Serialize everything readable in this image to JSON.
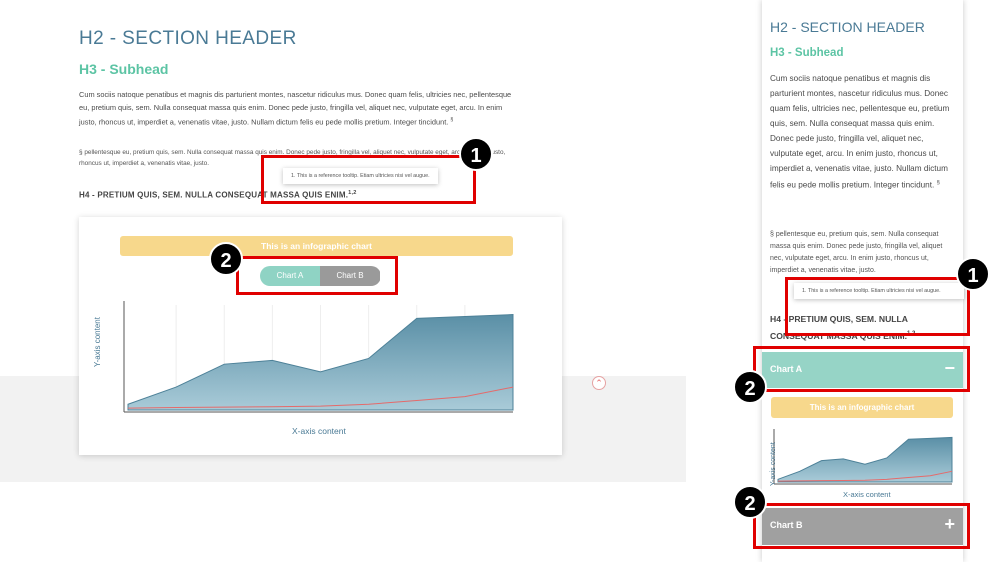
{
  "desktop": {
    "h2": "H2 - SECTION HEADER",
    "h3": "H3 - Subhead",
    "paragraph": "Cum sociis natoque penatibus et magnis dis parturient montes, nascetur ridiculus mus. Donec quam felis, ultricies nec, pellentesque eu, pretium quis, sem. Nulla consequat massa quis enim. Donec pede justo, fringilla vel, aliquet nec, vulputate eget, arcu. In enim justo, rhoncus ut, imperdiet a, venenatis vitae, justo. Nullam dictum felis eu pede mollis pretium. Integer tincidunt.",
    "paragraph_sup": "§",
    "small_text": "§ pellentesque eu, pretium quis, sem. Nulla consequat massa quis enim. Donec pede justo, fringilla vel, aliquet nec, vulputate eget, arcu. In enim justo, rhoncus ut, imperdiet a, venenatis vitae, justo.",
    "tooltip": "1. This is a reference tooltip. Etiam ultricies nisi vel augue.",
    "h4": "H4 - PRETIUM QUIS, SEM. NULLA CONSEQUAT MASSA QUIS ENIM.",
    "h4_sup": "1,2",
    "chart_banner": "This is an infographic chart",
    "toggle_a": "Chart A",
    "toggle_b": "Chart B",
    "ylabel": "Y-axis content",
    "xlabel": "X-axis content",
    "scroll_up_glyph": "⌃"
  },
  "mobile": {
    "h2": "H2 - SECTION HEADER",
    "h3": "H3 - Subhead",
    "paragraph": "Cum sociis natoque penatibus et magnis dis parturient montes, nascetur ridiculus mus. Donec quam felis, ultricies nec, pellentesque eu, pretium quis, sem. Nulla consequat massa quis enim. Donec pede justo, fringilla vel, aliquet nec, vulputate eget, arcu. In enim justo, rhoncus ut, imperdiet a, venenatis vitae, justo. Nullam dictum felis eu pede mollis pretium. Integer tincidunt.",
    "paragraph_sup": "§",
    "small_text": "§ pellentesque eu, pretium quis, sem. Nulla consequat massa quis enim. Donec pede justo, fringilla vel, aliquet nec, vulputate eget, arcu. In enim justo, rhoncus ut, imperdiet a, venenatis vitae, justo.",
    "tooltip": "1. This is a reference tooltip. Etiam ultricies nisi vel augue.",
    "h4": "H4 - PRETIUM QUIS, SEM. NULLA CONSEQUAT MASSA QUIS ENIM.",
    "h4_sup": "1,2",
    "accordion_a": "Chart A",
    "accordion_a_icon": "−",
    "accordion_b": "Chart B",
    "accordion_b_icon": "+",
    "chart_banner": "This is an infographic chart",
    "ylabel": "Y-axis content",
    "xlabel": "X-axis content"
  },
  "callouts": {
    "badge_1": "1",
    "badge_2": "2"
  },
  "colors": {
    "header_blue": "#4a7a95",
    "subhead_green": "#5cc4a4",
    "banner_yellow": "#f7d88c",
    "area_fill": "#5a8fa6",
    "trend_line": "#e56a6a",
    "callout_red": "#e00000"
  },
  "chart_data": {
    "type": "area",
    "title": "This is an infographic chart",
    "xlabel": "X-axis content",
    "ylabel": "Y-axis content",
    "x": [
      0,
      1,
      2,
      3,
      4,
      5,
      6,
      7,
      8
    ],
    "series": [
      {
        "values": [
          3,
          12,
          24,
          26,
          20,
          27,
          48,
          49,
          50
        ]
      },
      {
        "values": [
          1,
          1.3,
          1.5,
          1.7,
          2,
          3,
          5,
          7,
          12
        ]
      }
    ],
    "ylim": [
      0,
      55
    ],
    "grid": true
  }
}
